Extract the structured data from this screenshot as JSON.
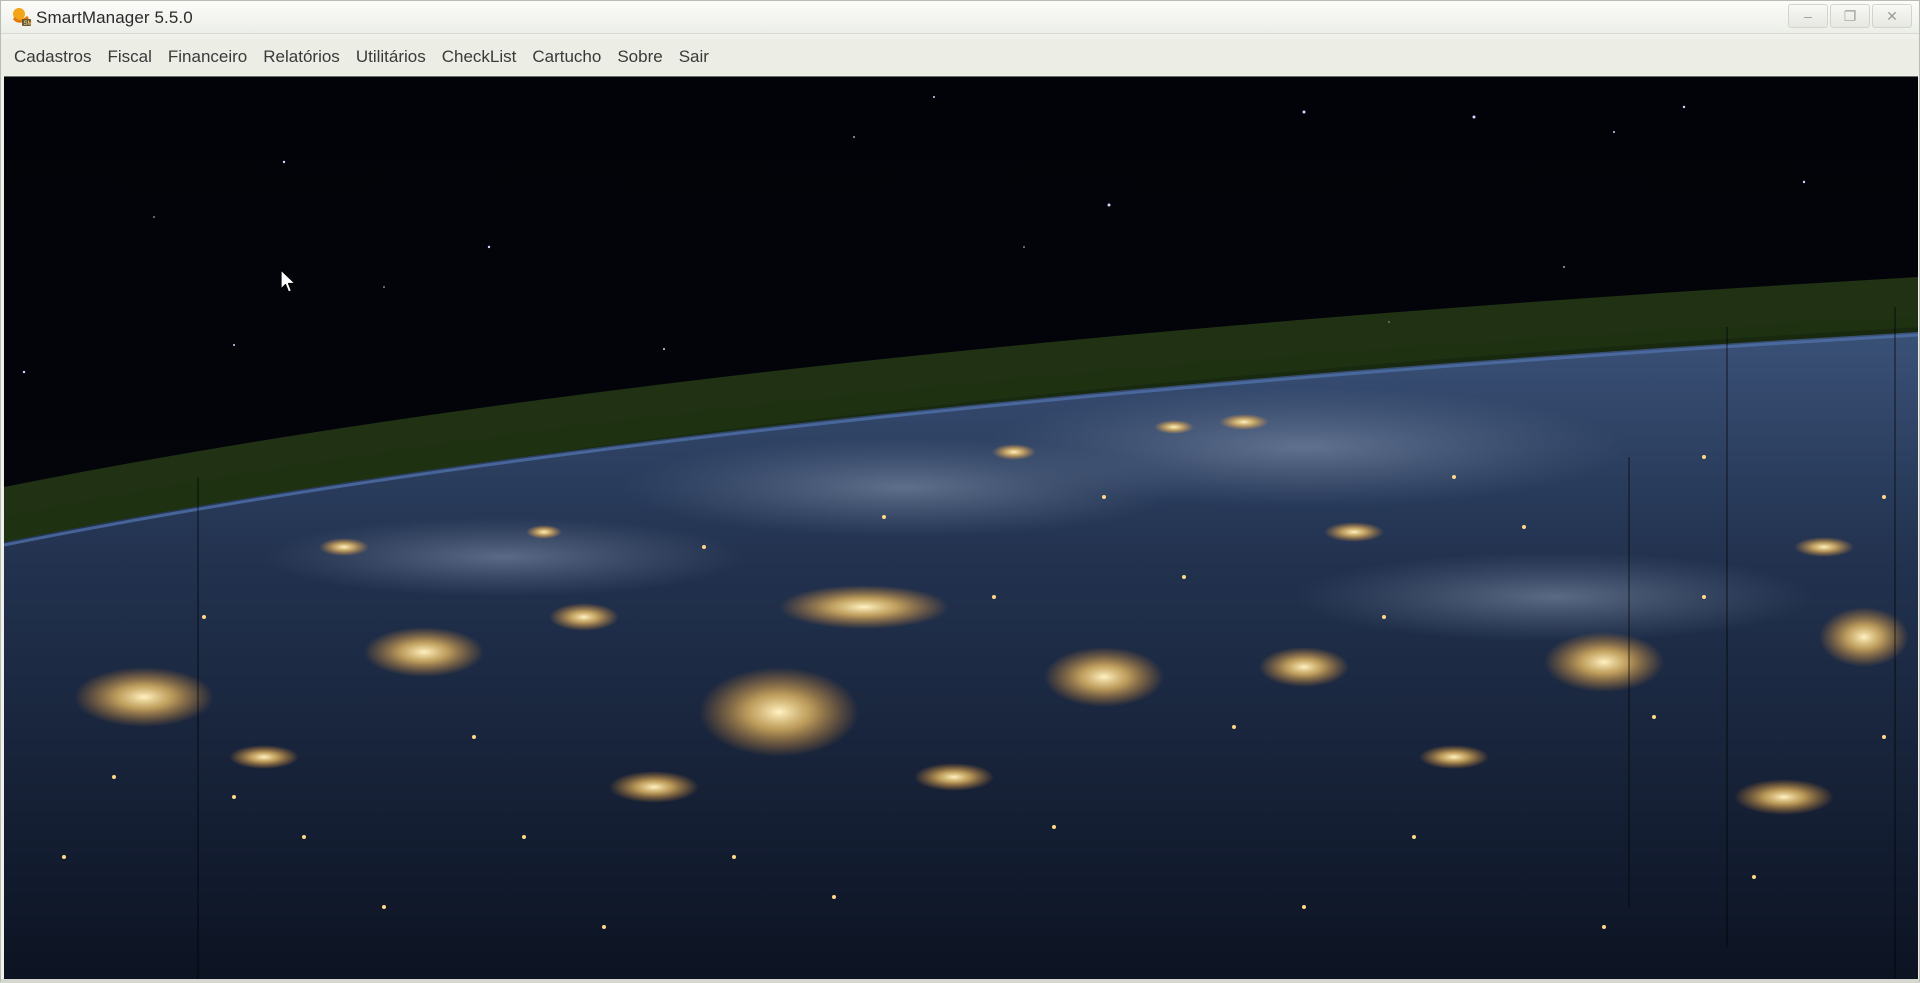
{
  "window": {
    "title": "SmartManager 5.5.0",
    "controls": {
      "minimize": "–",
      "maximize": "❐",
      "close": "✕"
    }
  },
  "menu": {
    "items": [
      {
        "label": "Cadastros"
      },
      {
        "label": "Fiscal"
      },
      {
        "label": "Financeiro"
      },
      {
        "label": "Relatórios"
      },
      {
        "label": "Utilitários"
      },
      {
        "label": "CheckList"
      },
      {
        "label": "Cartucho"
      },
      {
        "label": "Sobre"
      },
      {
        "label": "Sair"
      }
    ]
  },
  "desktop": {
    "wallpaper": "earth-at-night-from-orbit",
    "colors": {
      "space": "#020308",
      "atmosphere": "#2f4a1a",
      "ocean": "#1e2c45",
      "city_lights": "#ffd98a"
    }
  },
  "icons": {
    "app": "smartmanager-app-icon",
    "cursor": "mouse-pointer-icon"
  }
}
